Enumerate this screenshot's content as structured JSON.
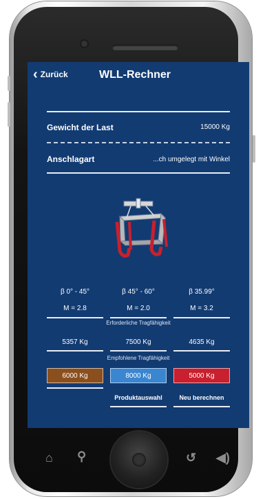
{
  "app": {
    "title": "WLL-Rechner",
    "back_label": "Zurück"
  },
  "load": {
    "label": "Gewicht der Last",
    "value": "15000 Kg"
  },
  "sling": {
    "label": "Anschlagart",
    "value": "...ch umgelegt mit Winkel"
  },
  "angles": [
    {
      "range": "β 0° - 45°",
      "factor": "M = 2.8"
    },
    {
      "range": "β 45° - 60°",
      "factor": "M = 2.0"
    },
    {
      "range": "β 35.99°",
      "factor": "M = 3.2"
    }
  ],
  "required": {
    "caption": "Erforderliche Tragfähigkeit",
    "values": [
      "5357 Kg",
      "7500 Kg",
      "4635 Kg"
    ]
  },
  "recommended": {
    "caption": "Empfohlene Tragfähigkeit",
    "values": [
      "6000 Kg",
      "8000 Kg",
      "5000 Kg"
    ],
    "colors": [
      "#8b4f1d",
      "#3a86d0",
      "#c8202e"
    ]
  },
  "actions": {
    "product_select": "Produktauswahl",
    "recalculate": "Neu berechnen"
  },
  "colors": {
    "screen_bg": "#123b72",
    "sling_red": "#c8202e"
  },
  "icons": [
    "home-icon",
    "search-icon",
    "back-arrow-icon",
    "speaker-icon"
  ]
}
